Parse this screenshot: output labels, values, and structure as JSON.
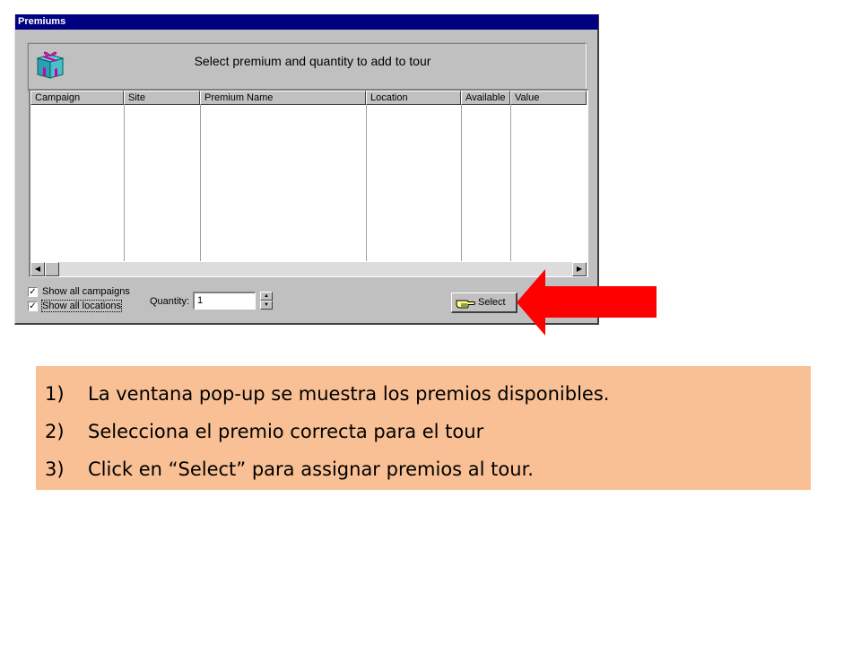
{
  "window": {
    "title": "Premiums",
    "banner_text": "Select premium and quantity to add to tour"
  },
  "table": {
    "columns": [
      {
        "label": "Campaign"
      },
      {
        "label": "Site"
      },
      {
        "label": "Premium Name"
      },
      {
        "label": "Location"
      },
      {
        "label": "Available"
      },
      {
        "label": "Value"
      }
    ],
    "rows": []
  },
  "scrollbar": {
    "left_arrow": "◀",
    "right_arrow": "▶"
  },
  "options": {
    "show_all_campaigns": {
      "label": "Show all campaigns",
      "checked": true,
      "mark": "✓"
    },
    "show_all_locations": {
      "label": "Show all locations",
      "checked": true,
      "mark": "✓"
    }
  },
  "quantity": {
    "label": "Quantity:",
    "value": "1",
    "up": "▲",
    "down": "▼"
  },
  "select_button": {
    "label": "Select"
  },
  "icons": {
    "banner": "gift-box-icon",
    "select": "pointing-hand-icon",
    "callout": "red-arrow-icon"
  },
  "colors": {
    "titlebar": "#000080",
    "callout_arrow": "#ff0000",
    "notes_background": "#f8c094"
  },
  "instructions": [
    {
      "num": "1)",
      "text": "La ventana pop-up se muestra los premios disponibles."
    },
    {
      "num": "2)",
      "text": "Selecciona el premio correcta para el tour"
    },
    {
      "num": "3)",
      "text": "Click en “Select” para assignar premios al tour."
    }
  ]
}
